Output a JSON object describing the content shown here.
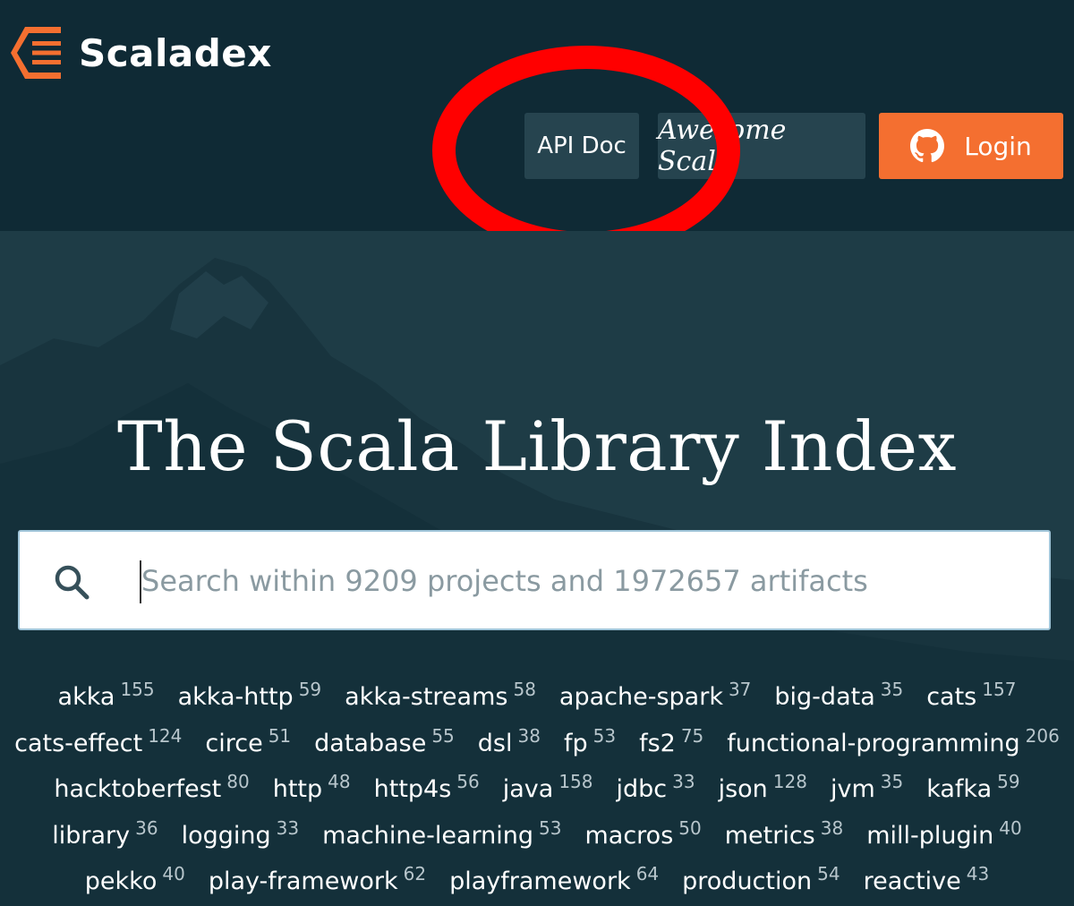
{
  "header": {
    "logo_text": "Scaladex",
    "nav": {
      "api_doc": "API Doc",
      "awesome_scala": "Awesome Scala",
      "login": "Login"
    }
  },
  "hero": {
    "title": "The Scala Library Index"
  },
  "search": {
    "placeholder": "Search within 9209 projects and 1972657 artifacts",
    "value": ""
  },
  "topics": [
    [
      {
        "name": "akka",
        "count": "155"
      },
      {
        "name": "akka-http",
        "count": "59"
      },
      {
        "name": "akka-streams",
        "count": "58"
      },
      {
        "name": "apache-spark",
        "count": "37"
      },
      {
        "name": "big-data",
        "count": "35"
      },
      {
        "name": "cats",
        "count": "157"
      }
    ],
    [
      {
        "name": "cats-effect",
        "count": "124"
      },
      {
        "name": "circe",
        "count": "51"
      },
      {
        "name": "database",
        "count": "55"
      },
      {
        "name": "dsl",
        "count": "38"
      },
      {
        "name": "fp",
        "count": "53"
      },
      {
        "name": "fs2",
        "count": "75"
      },
      {
        "name": "functional-programming",
        "count": "206"
      }
    ],
    [
      {
        "name": "hacktoberfest",
        "count": "80"
      },
      {
        "name": "http",
        "count": "48"
      },
      {
        "name": "http4s",
        "count": "56"
      },
      {
        "name": "java",
        "count": "158"
      },
      {
        "name": "jdbc",
        "count": "33"
      },
      {
        "name": "json",
        "count": "128"
      },
      {
        "name": "jvm",
        "count": "35"
      },
      {
        "name": "kafka",
        "count": "59"
      }
    ],
    [
      {
        "name": "library",
        "count": "36"
      },
      {
        "name": "logging",
        "count": "33"
      },
      {
        "name": "machine-learning",
        "count": "53"
      },
      {
        "name": "macros",
        "count": "50"
      },
      {
        "name": "metrics",
        "count": "38"
      },
      {
        "name": "mill-plugin",
        "count": "40"
      }
    ],
    [
      {
        "name": "pekko",
        "count": "40"
      },
      {
        "name": "play-framework",
        "count": "62"
      },
      {
        "name": "playframework",
        "count": "64"
      },
      {
        "name": "production",
        "count": "54"
      },
      {
        "name": "reactive",
        "count": "43"
      }
    ]
  ],
  "icons": {
    "logo": "scaladex-logo-icon",
    "github": "github-icon",
    "search": "search-icon"
  },
  "colors": {
    "header_bg": "#0f2a35",
    "hero_bg": "#1e3c46",
    "nav_button_bg": "#26444f",
    "login_bg": "#f46f30",
    "logo_accent": "#f46f30",
    "annotation": "#ff0000"
  }
}
